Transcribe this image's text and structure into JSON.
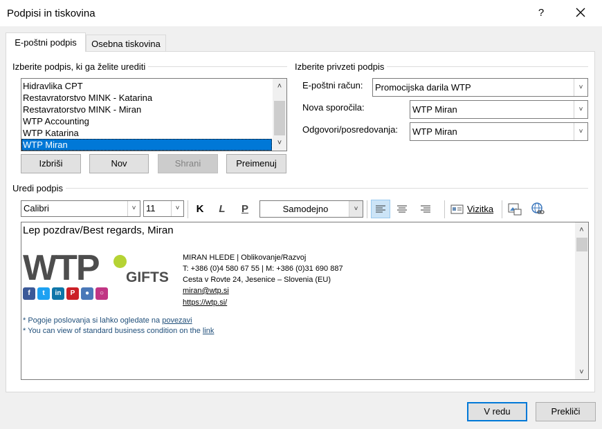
{
  "window": {
    "title": "Podpisi in tiskovina",
    "help": "?"
  },
  "tabs": [
    {
      "label": "E-poštni podpis",
      "active": true
    },
    {
      "label": "Osebna tiskovina",
      "active": false
    }
  ],
  "select_signature": {
    "label": "Izberite podpis, ki ga želite urediti",
    "items": [
      "Hidravlika CPT",
      "Restavratorstvo MINK - Katarina",
      "Restavratorstvo MINK - Miran",
      "WTP Accounting",
      "WTP Katarina",
      "WTP Miran"
    ],
    "selected": "WTP Miran"
  },
  "buttons": {
    "delete": "Izbriši",
    "new": "Nov",
    "save": "Shrani",
    "rename": "Preimenuj",
    "ok": "V redu",
    "cancel": "Prekliči"
  },
  "default_signature": {
    "label": "Izberite privzeti podpis",
    "account_label": "E-poštni račun:",
    "account_value": "Promocijska darila WTP",
    "new_messages_label": "Nova sporočila:",
    "new_messages_value": "WTP Miran",
    "replies_label": "Odgovori/posredovanja:",
    "replies_value": "WTP Miran"
  },
  "edit_signature": {
    "label": "Uredi podpis",
    "font": "Calibri",
    "size": "11",
    "bold": "K",
    "italic": "L",
    "underline": "P",
    "color": "Samodejno",
    "business_card": "Vizitka"
  },
  "signature": {
    "greeting": "Lep pozdrav/Best regards, Miran",
    "logo_text": "WTP",
    "logo_gifts": "GIFTS",
    "name_line": "MIRAN HLEDE | Oblikovanje/Razvoj",
    "phone_line": "T: +386 (0)4 580 67 55 | M: +386 (0)31 690 887",
    "address_line": "Cesta v Rovte 24, Jesenice – Slovenia (EU)",
    "email": "miran@wtp.si",
    "website": "https://wtp.si/",
    "terms_sl_prefix": "* Pogoje poslovanja si lahko ogledate na ",
    "terms_sl_link": "povezavi",
    "terms_en_prefix": "* You can view of standard business condition on the ",
    "terms_en_link": "link"
  },
  "social_icons": [
    "facebook-icon",
    "twitter-icon",
    "linkedin-icon",
    "pinterest-icon",
    "flickr-icon",
    "instagram-icon"
  ],
  "colors": {
    "selection": "#0078d7",
    "logo_green": "#b5d334",
    "link": "#0563c1",
    "terms_text": "#1f4e79"
  }
}
